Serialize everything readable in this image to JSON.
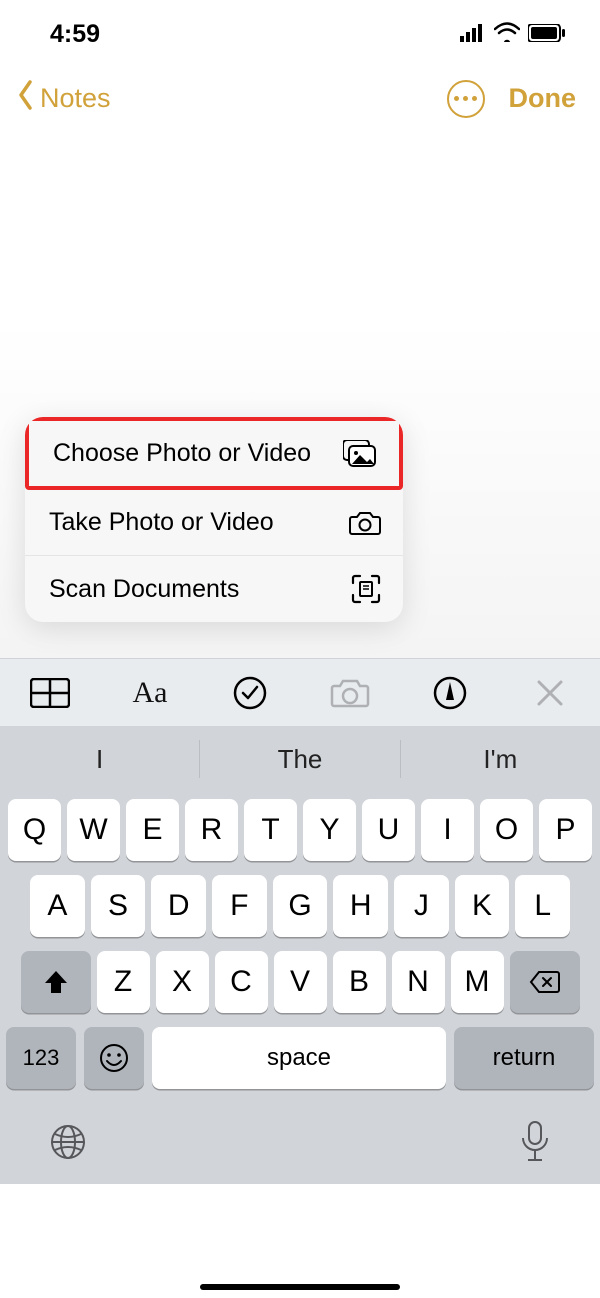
{
  "status": {
    "time": "4:59"
  },
  "nav": {
    "back_label": "Notes",
    "done_label": "Done"
  },
  "popup": {
    "items": [
      {
        "label": "Choose Photo or Video",
        "icon": "photo-library-icon",
        "highlight": true
      },
      {
        "label": "Take Photo or Video",
        "icon": "camera-icon",
        "highlight": false
      },
      {
        "label": "Scan Documents",
        "icon": "scan-icon",
        "highlight": false
      }
    ]
  },
  "note_toolbar": {
    "tools": [
      "table",
      "format",
      "checklist",
      "camera",
      "draw",
      "close"
    ]
  },
  "keyboard": {
    "suggestions": [
      "I",
      "The",
      "I'm"
    ],
    "row1": [
      "Q",
      "W",
      "E",
      "R",
      "T",
      "Y",
      "U",
      "I",
      "O",
      "P"
    ],
    "row2": [
      "A",
      "S",
      "D",
      "F",
      "G",
      "H",
      "J",
      "K",
      "L"
    ],
    "row3": [
      "Z",
      "X",
      "C",
      "V",
      "B",
      "N",
      "M"
    ],
    "num_label": "123",
    "space_label": "space",
    "return_label": "return"
  }
}
